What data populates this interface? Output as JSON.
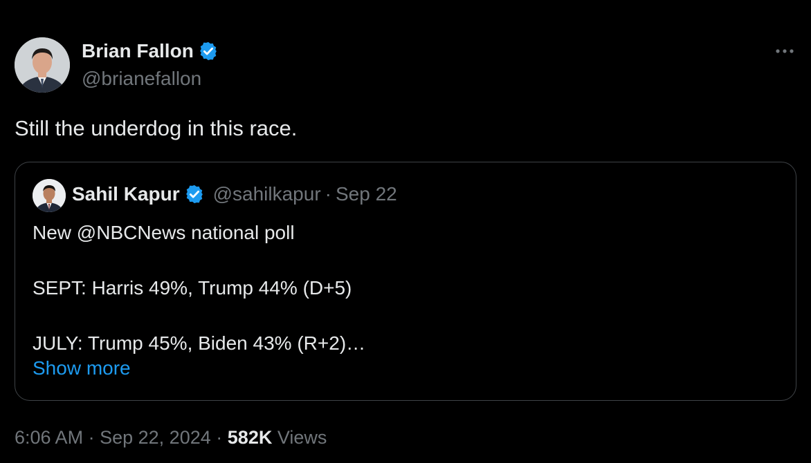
{
  "tweet": {
    "author": {
      "name": "Brian Fallon",
      "handle": "@brianefallon"
    },
    "text": "Still the underdog in this race.",
    "quoted": {
      "author": {
        "name": "Sahil Kapur",
        "handle": "@sahilkapur"
      },
      "separator": "·",
      "date": "Sep 22",
      "lines": [
        "New @NBCNews national poll",
        "",
        "SEPT: Harris 49%, Trump 44% (D+5)",
        "",
        "JULY: Trump 45%, Biden 43% (R+2)…"
      ],
      "show_more": "Show more"
    },
    "meta": {
      "time": "6:06 AM",
      "separator": "·",
      "date": "Sep 22, 2024",
      "views_count": "582K",
      "views_label": "Views"
    }
  },
  "icons": {
    "verified": "verified-badge-icon",
    "more": "more-dots-icon"
  },
  "colors": {
    "background": "#000000",
    "primary_text": "#e7e9ea",
    "secondary_text": "#71767b",
    "link": "#1d9bf0",
    "verified": "#1d9bf0",
    "border": "#3f4347"
  }
}
